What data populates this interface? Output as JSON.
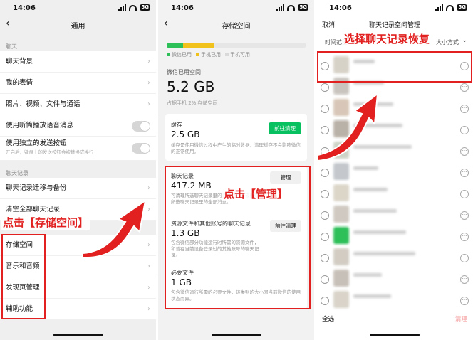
{
  "status": {
    "time": "14:06",
    "battery": "5G"
  },
  "screen1": {
    "nav_title": "通用",
    "section_chat": "聊天",
    "items_chat": [
      {
        "label": "聊天背景"
      },
      {
        "label": "我的表情"
      },
      {
        "label": "照片、视频、文件与通话"
      },
      {
        "label": "使用听筒播放语音消息"
      },
      {
        "label": "使用独立的发送按钮"
      }
    ],
    "send_btn_note": "开启后，键盘上的发送按钮会被替换成换行",
    "section_records": "聊天记录",
    "items_records": [
      {
        "label": "聊天记录迁移与备份"
      },
      {
        "label": "清空全部聊天记录"
      }
    ],
    "items_more": [
      {
        "label": "存储空间"
      },
      {
        "label": "音乐和音频"
      },
      {
        "label": "发现页管理"
      },
      {
        "label": "辅助功能"
      }
    ],
    "annotation": "点击【存储空间】"
  },
  "screen2": {
    "nav_title": "存储空间",
    "legend": [
      "微信已用",
      "手机已用",
      "手机可用"
    ],
    "used_label": "微信已用空间",
    "used_value": "5.2 GB",
    "used_sub": "占据手机 2% 存储空间",
    "cache_label": "缓存",
    "cache_value": "2.5 GB",
    "cache_desc": "缓存是使用微信过程中产生的临时数据，清理缓存不会影响微信的正常使用。",
    "cache_btn": "前往清理",
    "chat_label": "聊天记录",
    "chat_value": "417.2 MB",
    "chat_desc": "可清理所选聊天记录里的资源文件，或删除所选聊天记录里的全部消息。",
    "chat_btn": "管理",
    "res_label": "资源文件和其他账号的聊天记录",
    "res_value": "1.3 GB",
    "res_desc": "包含微信部分功能运行时所需的资源文件，和曾在当前设备登录过的其他账号的聊天记录。",
    "res_btn": "前往清理",
    "req_label": "必要文件",
    "req_value": "1 GB",
    "req_desc": "包含微信运行所需的必要文件，该类别的大小因当前微信的使用状态而异。",
    "annotation": "点击【管理】"
  },
  "screen3": {
    "cancel": "取消",
    "nav_title": "聊天记录空间管理",
    "sort_left": "时间范围",
    "sort_right": "大小方式",
    "select_all": "全选",
    "delete": "清理",
    "annotation": "选择聊天记录恢复"
  },
  "colors": {
    "accent_red": "#e1201f",
    "wechat_green": "#07c160"
  }
}
